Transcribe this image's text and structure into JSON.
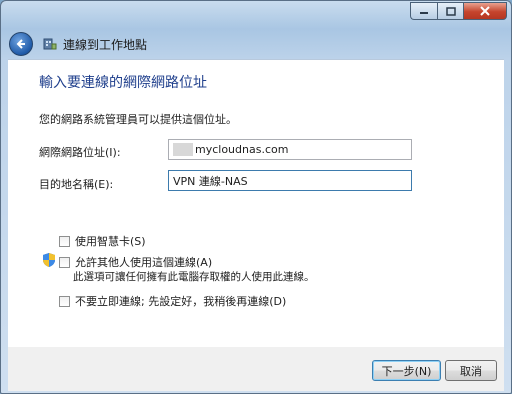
{
  "window": {
    "nav_title": "連線到工作地點"
  },
  "main": {
    "heading": "輸入要連線的網際網路位址",
    "description": "您的網路系統管理員可以提供這個位址。"
  },
  "form": {
    "address_label": "網際網路位址(I):",
    "address_value": "mycloudnas.com",
    "destination_label": "目的地名稱(E):",
    "destination_value": "VPN 連線-NAS"
  },
  "options": {
    "smartcard_label": "使用智慧卡(S)",
    "allow_others_label": "允許其他人使用這個連線(A)",
    "allow_others_note": "此選項可讓任何擁有此電腦存取權的人使用此連線。",
    "dont_connect_label": "不要立即連線; 先設定好，我稍後再連線(D)"
  },
  "buttons": {
    "next": "下一步(N)",
    "cancel": "取消"
  },
  "icons": {
    "back": "back-arrow-icon",
    "app": "network-workplace-icon",
    "shield": "uac-shield-icon"
  },
  "colors": {
    "heading": "#1f3f8c",
    "close_button": "#c5442c"
  }
}
